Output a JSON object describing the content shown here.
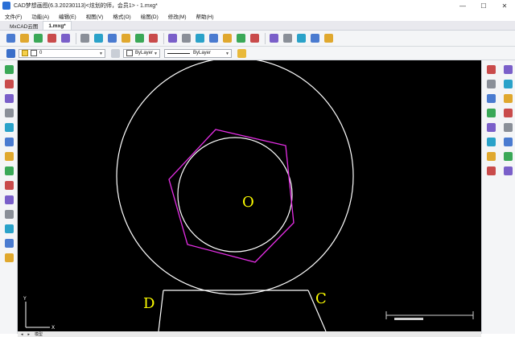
{
  "window": {
    "title": "CAD梦想画图(6.3.20230113)<炫划的师，会员1> - 1.mxg*",
    "minimize": "—",
    "maximize": "☐",
    "close": "✕"
  },
  "menu": [
    "文件(F)",
    "功能(A)",
    "编辑(E)",
    "视图(V)",
    "格式(O)",
    "绘图(D)",
    "修改(M)",
    "帮助(H)"
  ],
  "tabs": [
    {
      "label": "MxCAD云图"
    },
    {
      "label": "1.mxg*",
      "active": true
    }
  ],
  "properties": {
    "layer_value": "0",
    "color_value": "ByLayer",
    "linetype_value": "ByLayer"
  },
  "drawing": {
    "labels": [
      "O",
      "D",
      "C"
    ],
    "circle_color": "#ffffff",
    "polygon_color": "#e62ee6",
    "label_color": "#ffff00"
  },
  "status_tabs": [
    "◂",
    "▸",
    "模型"
  ],
  "icons": {
    "toolbar": [
      "new-file-icon",
      "open-file-icon",
      "save-icon",
      "save-as-icon",
      "print-icon",
      "zoom-window-icon",
      "zoom-extents-icon",
      "pan-icon",
      "measure-icon",
      "zoom-realtime-icon",
      "pencil-icon",
      "table-icon",
      "layer-icon",
      "block-icon",
      "image-icon",
      "copy-icon",
      "undo-icon",
      "redo-icon",
      "plot-icon",
      "cloud-icon",
      "globe-icon",
      "pdf-icon",
      "export-icon"
    ],
    "left": [
      "line-icon",
      "polyline-icon",
      "arc-icon",
      "rectangle-icon",
      "polygon-icon",
      "circle-icon",
      "spline-icon",
      "ellipse-icon",
      "hatch-icon",
      "point-icon",
      "text-icon",
      "insert-block-icon",
      "multiline-text-icon",
      "table-insert-icon"
    ],
    "right": [
      "dimension-icon",
      "erase-icon",
      "move-icon",
      "rotate-icon",
      "scale-icon",
      "copy-obj-icon",
      "mirror-icon",
      "offset-icon",
      "array-icon",
      "trim-icon",
      "extend-icon",
      "break-icon",
      "fillet-icon",
      "chamfer-icon",
      "explode-icon",
      "stretch-icon"
    ]
  }
}
